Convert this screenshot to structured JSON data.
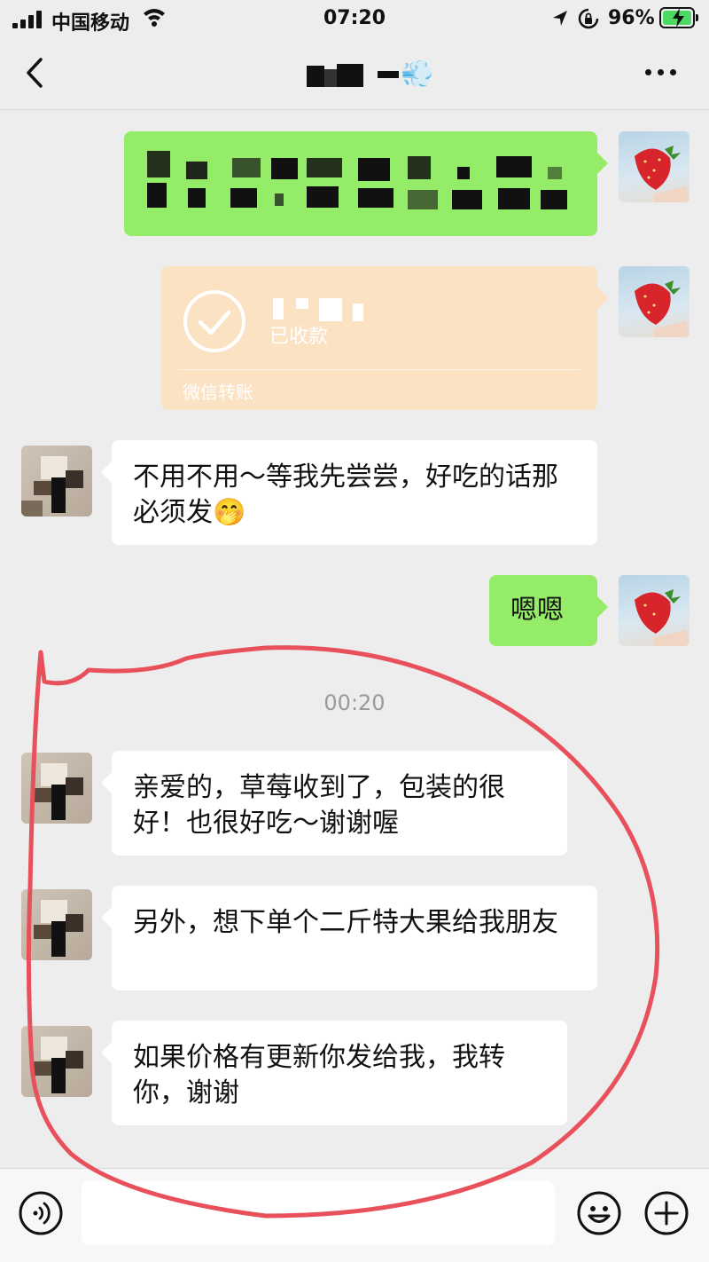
{
  "status_bar": {
    "carrier": "中国移动",
    "time": "07:20",
    "battery_percent": "96%",
    "icons": [
      "signal-icon",
      "wifi-icon",
      "location-icon",
      "orientation-lock-icon",
      "battery-charging-icon"
    ]
  },
  "nav": {
    "icons": [
      "back-icon",
      "more-icon"
    ],
    "title_emoji": "💨"
  },
  "transfer": {
    "status": "已收款",
    "label": "微信转账"
  },
  "messages": [
    {
      "from": "peer",
      "text": "不用不用～等我先尝尝，好吃的话那必须发🤭"
    },
    {
      "from": "self",
      "text": "嗯嗯"
    }
  ],
  "timestamp": "00:20",
  "messages_after": [
    {
      "from": "peer",
      "text": "亲爱的，草莓收到了，包装的很好！也很好吃～谢谢喔"
    },
    {
      "from": "peer",
      "text": "另外，想下单个二斤特大果给我朋友"
    },
    {
      "from": "peer",
      "text": "如果价格有更新你发给我，我转你，谢谢"
    }
  ],
  "input_bar": {
    "placeholder": "",
    "icons": [
      "voice-icon",
      "emoji-icon",
      "plus-icon"
    ]
  },
  "colors": {
    "background": "#ededed",
    "self_bubble": "#95ec69",
    "peer_bubble": "#ffffff",
    "transfer_card": "#fbe2c3",
    "annotation": "#e8505b"
  }
}
